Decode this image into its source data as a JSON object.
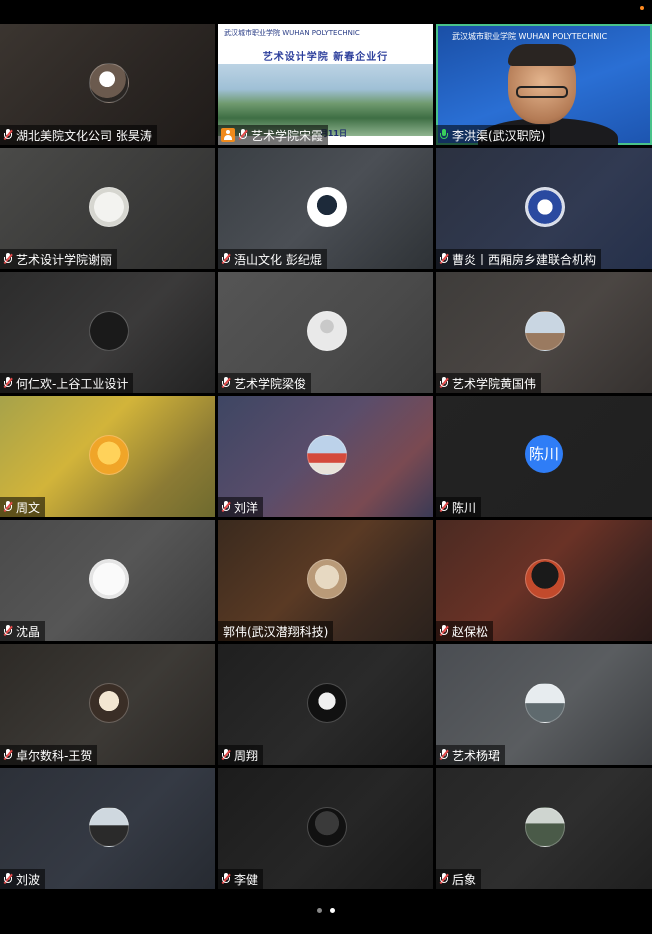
{
  "meeting": {
    "pages_indicator": {
      "total": 2,
      "current": 2
    },
    "tiles": [
      {
        "name": "湖北美院文化公司 张昊涛",
        "mic": "muted",
        "bg": "linear-gradient(135deg,#3b3530,#2a2522 60%,#1f1b19)",
        "avatar": "radial-gradient(circle at 45% 40%,#fff 0 25%,#6b5a4e 26% 60%,#2a2623 61%)"
      },
      {
        "name": "艺术学院宋霞",
        "mic": "muted",
        "presenter": true,
        "slide": {
          "logo": "武汉城市职业学院 WUHAN POLYTECHNIC",
          "title": "艺术设计学院   新春企业行",
          "date": "月11日"
        }
      },
      {
        "name": "李洪渠(武汉职院)",
        "mic": "active",
        "speaker": true,
        "banner": "武汉城市职业学院 WUHAN POLYTECHNIC"
      },
      {
        "name": "艺术设计学院谢丽",
        "mic": "muted",
        "bg": "linear-gradient(135deg,#4a4a48,#3a3a39 60%,#2e2e2d)",
        "avatar": "radial-gradient(circle,#f3f3f0 0 55%,#d6d6d0 56%)"
      },
      {
        "name": "浯山文化  彭纪焜",
        "mic": "muted",
        "bg": "linear-gradient(135deg,#3a3f44,#4b4f55 50%,#2e3236)",
        "avatar": "radial-gradient(circle at 50% 45%,#1d2a3a 0 35%,#ffffff 36%)"
      },
      {
        "name": "曹炎丨西厢房乡建联合机构",
        "mic": "muted",
        "bg": "linear-gradient(135deg,#2b3140,#313a52 60%,#25304a)",
        "avatar": "radial-gradient(circle,#ffffff 0 28%,#2a4aa0 29% 62%,#d7dce8 63%)"
      },
      {
        "name": "何仁欢-上谷工业设计",
        "mic": "muted",
        "bg": "linear-gradient(135deg,#2c2c2c,#3b3a3a 55%,#222)",
        "avatar": "radial-gradient(circle,#1a1a1a 0 70%,#2a2a2a 71%)"
      },
      {
        "name": "艺术学院梁俊",
        "mic": "muted",
        "bg": "linear-gradient(135deg,#555,#4a4a4a 60%,#3d3d3d)",
        "avatar": "radial-gradient(circle at 50% 38%,#c9c9c9 0 22%,#e9e9e9 23%)"
      },
      {
        "name": "艺术学院黄国伟",
        "mic": "muted",
        "bg": "linear-gradient(135deg,#3e3c3a,#4b4643 55%,#35312f)",
        "avatar": "linear-gradient(180deg,#c9d6e2 0 55%,#9a7a60 56%)"
      },
      {
        "name": "周文",
        "mic": "muted",
        "bg": "linear-gradient(135deg,#a6a24a,#d2b43a 40%,#8c7b34 75%,#6e6a2e)",
        "avatar": "radial-gradient(circle at 50% 45%,#ffd25a 0 40%,#f0a528 41%)"
      },
      {
        "name": "刘洋",
        "mic": "muted",
        "bg": "linear-gradient(135deg,#3e4663,#5a4d6b 45%,#7a4a52 75%,#3a3a55)",
        "avatar": "linear-gradient(180deg,#bcd2ea 0 45%,#d44a3c 46% 70%,#e8e3da 71%)"
      },
      {
        "name": "陈川",
        "mic": "muted",
        "bg": "linear-gradient(135deg,#232323,#202020)",
        "avatar_letter": "陈川"
      },
      {
        "name": "沈晶",
        "mic": "muted",
        "bg": "linear-gradient(135deg,#4a4a4a,#565656 50%,#3c3c3c)",
        "avatar": "radial-gradient(circle,#fafafa 0 60%,#e4e4e4 61%)"
      },
      {
        "name": "郭伟(武汉潜翔科技)",
        "mic": "none",
        "bg": "linear-gradient(135deg,#3a2a1e,#5a3a24 45%,#3d2b21 70%,#2a211c)",
        "avatar": "radial-gradient(circle at 50% 45%,#e7d9c2 0 42%,#b99a78 43%)"
      },
      {
        "name": "赵保松",
        "mic": "muted",
        "bg": "linear-gradient(135deg,#4a2a22,#6a3226 45%,#3e2420 75%,#2a1a18)",
        "avatar": "radial-gradient(circle at 50% 40%,#1a1a1a 0 45%,#c24a2c 46%)"
      },
      {
        "name": "卓尔数科-王贺",
        "mic": "muted",
        "bg": "linear-gradient(135deg,#2d2a26,#3d3a36 55%,#2a2724)",
        "avatar": "radial-gradient(circle at 50% 45%,#f2e6d2 0 35%,#3a2e26 36%)"
      },
      {
        "name": "周翔",
        "mic": "muted",
        "bg": "linear-gradient(135deg,#1f1f1f,#2a2a2a 55%,#1b1b1b)",
        "avatar": "radial-gradient(circle at 50% 45%,#f0f0f0 0 30%,#111 31%)"
      },
      {
        "name": "艺术杨珺",
        "mic": "muted",
        "bg": "linear-gradient(135deg,#4a4d52,#5a5d60 55%,#3b3d40)",
        "avatar": "linear-gradient(180deg,#e7ecef 0 50%,#5f6a6e 51%)"
      },
      {
        "name": "刘波",
        "mic": "muted",
        "bg": "linear-gradient(135deg,#2c3038,#353a44 55%,#262a31)",
        "avatar": "linear-gradient(180deg,#cfd8df 0 45%,#2a2a2a 46%)"
      },
      {
        "name": "李健",
        "mic": "muted",
        "bg": "linear-gradient(135deg,#1c1c1c,#262626 55%,#191919)",
        "avatar": "radial-gradient(circle at 50% 40%,#3a3a3a 0 40%,#111 41%)"
      },
      {
        "name": "后象",
        "mic": "muted",
        "bg": "linear-gradient(135deg,#262626,#2e2e2e 55%,#1f1f1f)",
        "avatar": "linear-gradient(180deg,#cfd5d0 0 40%,#4a5a48 41%)"
      }
    ]
  }
}
